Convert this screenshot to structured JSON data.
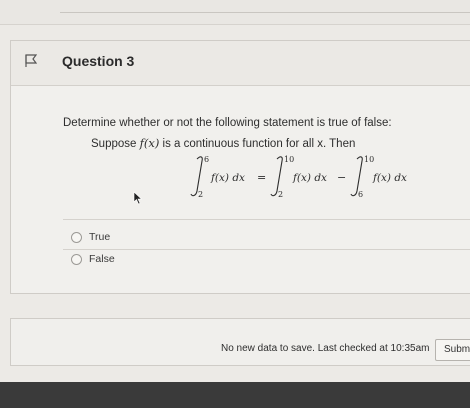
{
  "question": {
    "title": "Question 3",
    "prompt": "Determine whether or not the following statement is true of false:",
    "statement_prefix": "Suppose ",
    "statement_func": "f(x)",
    "statement_suffix": " is a continuous function for all x. Then",
    "equation": {
      "lhs_lower": "2",
      "lhs_upper": "6",
      "rhs1_lower": "2",
      "rhs1_upper": "10",
      "rhs2_lower": "6",
      "rhs2_upper": "10",
      "integrand": "f(x) dx",
      "equals": "=",
      "minus": "−"
    },
    "options": [
      {
        "label": "True"
      },
      {
        "label": "False"
      }
    ]
  },
  "footer": {
    "status": "No new data to save. Last checked at 10:35am",
    "submit_label": "Submit"
  }
}
